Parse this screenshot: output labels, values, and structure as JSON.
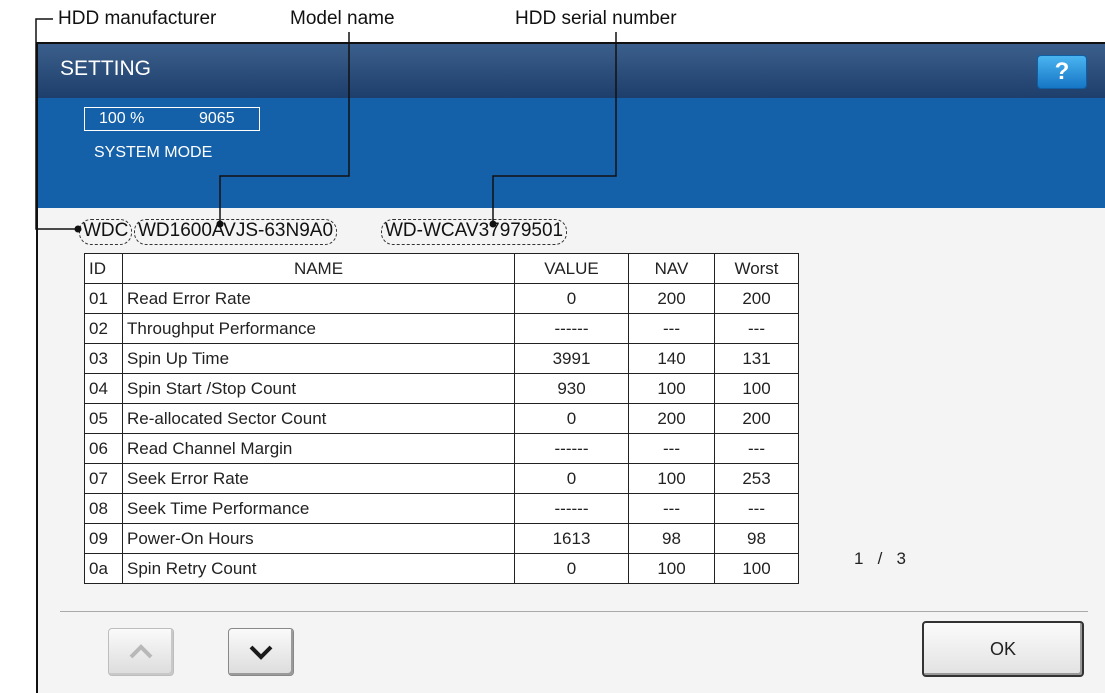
{
  "callouts": {
    "manufacturer": "HDD manufacturer",
    "model": "Model name",
    "serial": "HDD serial number"
  },
  "header": {
    "title": "SETTING",
    "help_label": "?"
  },
  "status": {
    "percent": "100 %",
    "count": "9065",
    "mode": "SYSTEM MODE"
  },
  "hdd": {
    "manufacturer": "WDC",
    "model": "WD1600AVJS-63N9A0",
    "serial": "WD-WCAV37979501"
  },
  "table": {
    "headers": {
      "id": "ID",
      "name": "NAME",
      "value": "VALUE",
      "nav": "NAV",
      "worst": "Worst"
    },
    "rows": [
      {
        "id": "01",
        "name": "Read Error Rate",
        "value": "0",
        "nav": "200",
        "worst": "200"
      },
      {
        "id": "02",
        "name": "Throughput Performance",
        "value": "------",
        "nav": "---",
        "worst": "---"
      },
      {
        "id": "03",
        "name": "Spin Up Time",
        "value": "3991",
        "nav": "140",
        "worst": "131"
      },
      {
        "id": "04",
        "name": "Spin Start /Stop Count",
        "value": "930",
        "nav": "100",
        "worst": "100"
      },
      {
        "id": "05",
        "name": "Re-allocated Sector Count",
        "value": "0",
        "nav": "200",
        "worst": "200"
      },
      {
        "id": "06",
        "name": "Read Channel Margin",
        "value": "------",
        "nav": "---",
        "worst": "---"
      },
      {
        "id": "07",
        "name": "Seek Error Rate",
        "value": "0",
        "nav": "100",
        "worst": "253"
      },
      {
        "id": "08",
        "name": "Seek Time Performance",
        "value": "------",
        "nav": "---",
        "worst": "---"
      },
      {
        "id": "09",
        "name": "Power-On Hours",
        "value": "1613",
        "nav": "98",
        "worst": "98"
      },
      {
        "id": "0a",
        "name": "Spin Retry Count",
        "value": "0",
        "nav": "100",
        "worst": "100"
      }
    ]
  },
  "pagination": {
    "current": "1",
    "separator": "/",
    "total": "3"
  },
  "buttons": {
    "up_icon": "chevron-up-icon",
    "down_icon": "chevron-down-icon",
    "ok_label": "OK"
  },
  "colors": {
    "title_bar": "#1e3e6b",
    "status_area": "#1561a9",
    "help_button": "#1676c5"
  }
}
